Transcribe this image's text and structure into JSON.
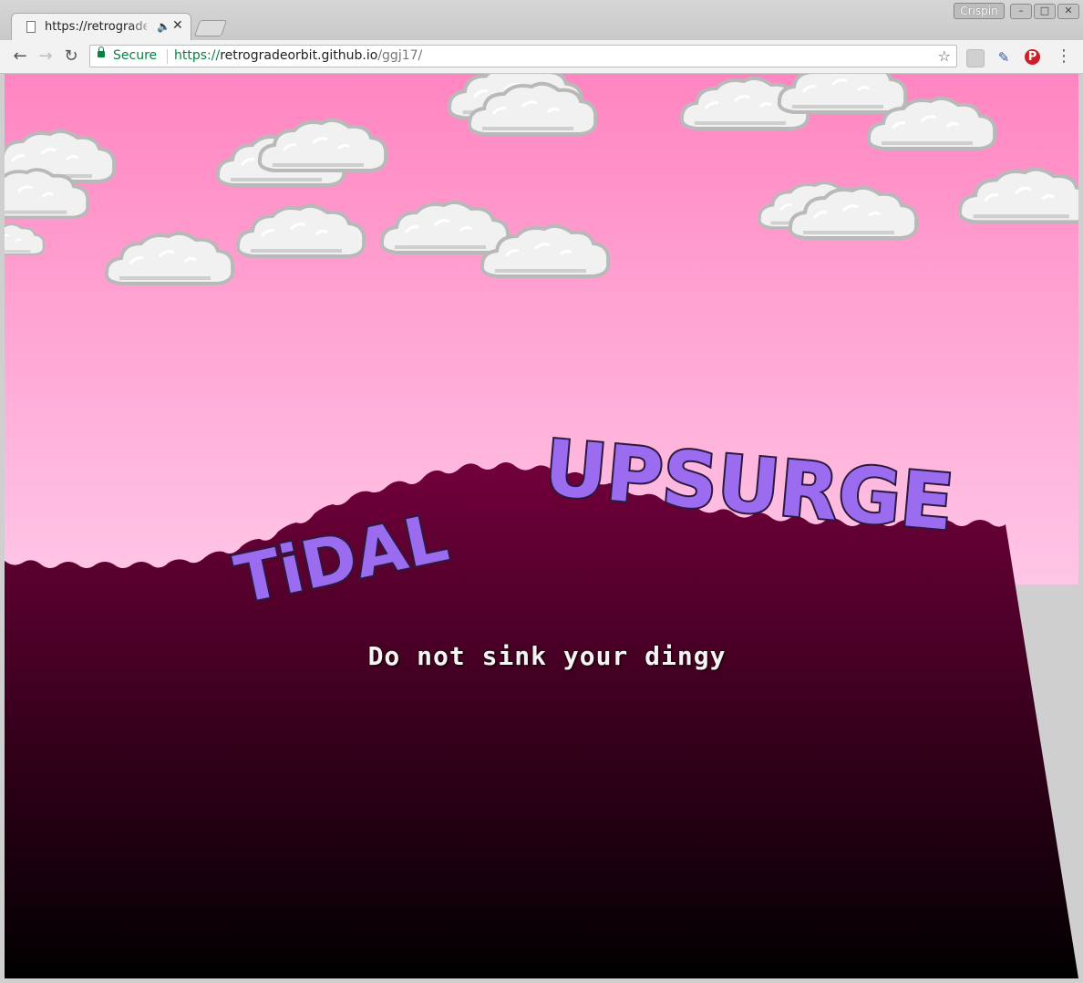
{
  "browser": {
    "tab": {
      "title": "https://retrograde",
      "audio_icon": "speaker-icon"
    },
    "profile_name": "Crispin",
    "window_controls": {
      "minimize": "–",
      "maximize": "□",
      "close": "✕"
    },
    "omnibox": {
      "security_label": "Secure",
      "url_scheme": "https://",
      "url_host": "retrogradeorbit.github.io",
      "url_path": "/ggj17/"
    },
    "extensions": [
      "extension-icon",
      "eyedropper-icon",
      "pinterest-icon"
    ]
  },
  "game": {
    "title_word_1": "TiDAL",
    "title_word_2": "UPSURGE",
    "subtitle": "Do not sink your dingy",
    "colors": {
      "sky_top": "#ff85c1",
      "sky_bottom": "#ffc2e4",
      "sea_top": "#6e003a",
      "sea_bottom": "#000000",
      "title_fill": "#9b6bf0",
      "title_outline": "#2c1a3e",
      "cloud": "#f1f1f1"
    }
  }
}
